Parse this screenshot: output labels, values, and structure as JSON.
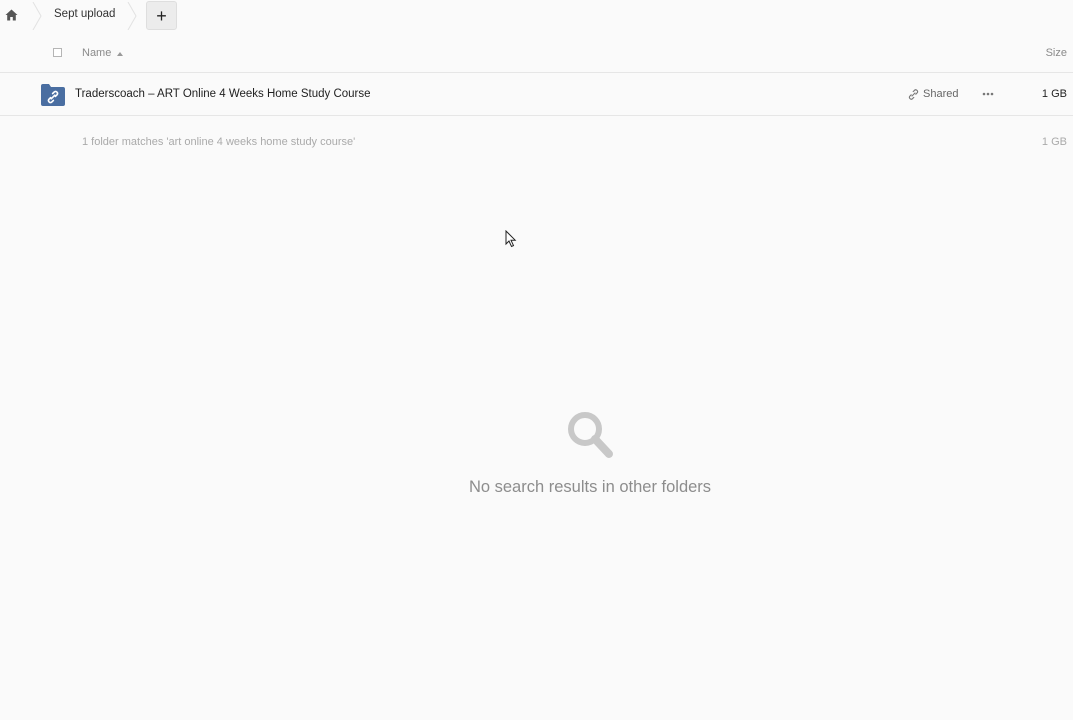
{
  "breadcrumb": {
    "home_icon": "home-icon",
    "folder": "Sept upload",
    "add_label": "+"
  },
  "table_header": {
    "name": "Name",
    "size": "Size",
    "sort_icon": "sort-ascending-icon"
  },
  "files": [
    {
      "name": "Traderscoach – ART Online 4 Weeks Home Study Course",
      "icon": "shared-folder-icon",
      "share_label": "Shared",
      "more_icon": "more-options-icon",
      "size": "1 GB"
    }
  ],
  "summary": {
    "text": "1 folder matches 'art online 4 weeks home study course'",
    "size": "1 GB"
  },
  "empty_state": {
    "icon": "search-icon",
    "text": "No search results in other folders"
  },
  "colors": {
    "folder_blue": "#4a6ea1",
    "background": "#fafafa",
    "muted_text": "#8d8d8d"
  }
}
